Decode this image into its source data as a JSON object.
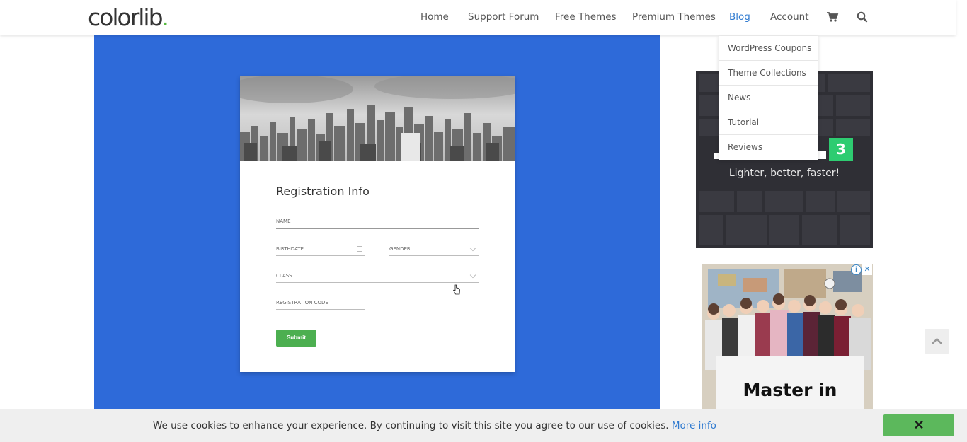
{
  "header": {
    "logo_text": "colorlib",
    "logo_dot": ".",
    "nav": [
      {
        "label": "Home"
      },
      {
        "label": "Support Forum"
      },
      {
        "label": "Free Themes"
      },
      {
        "label": "Premium Themes"
      },
      {
        "label": "Blog",
        "active": true
      },
      {
        "label": "Account"
      }
    ],
    "cart_icon": "cart-icon",
    "search_icon": "search-icon"
  },
  "blog_dropdown": {
    "items": [
      {
        "label": "WordPress Coupons"
      },
      {
        "label": "Theme Collections"
      },
      {
        "label": "News"
      },
      {
        "label": "Tutorial"
      },
      {
        "label": "Reviews"
      }
    ]
  },
  "hero": {
    "background": "#2e6ad9",
    "form": {
      "title": "Registration Info",
      "fields": {
        "name": "NAME",
        "birthdate": "BIRTHDATE",
        "gender": "GENDER",
        "class": "CLASS",
        "registration_code": "REGISTRATION CODE"
      },
      "submit_label": "Submit"
    }
  },
  "sidebar": {
    "ad1": {
      "badge": "3",
      "tagline": "Lighter, better, faster!"
    },
    "ad2": {
      "title": "Master in",
      "info_icon": "info-icon",
      "close_icon": "close-icon"
    }
  },
  "cookie_bar": {
    "text": "We use cookies to enhance your experience. By continuing to visit this site you agree to our use of cookies.",
    "link": "More info",
    "close_label": "✕"
  },
  "colors": {
    "accent": "#2f7ad0",
    "brand_green": "#55b83f",
    "submit_green": "#4caf50",
    "cookie_button": "#5cb85c"
  }
}
